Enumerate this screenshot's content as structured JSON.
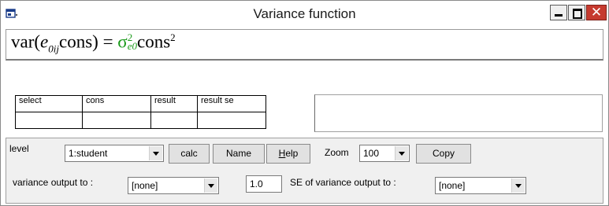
{
  "window": {
    "title": "Variance function"
  },
  "formula": {
    "lhs_func": "var(",
    "lhs_var": "e",
    "lhs_sub": "0ij",
    "lhs_term": "cons",
    "close_eq": ") = ",
    "sigma": "σ",
    "sigma_sup": "2",
    "sigma_sub": "e0",
    "rhs_term": "cons",
    "rhs_sup": "2",
    "sigma_color": "#1a9a1a"
  },
  "table": {
    "headers": [
      "select",
      "cons",
      "result",
      "result se"
    ],
    "row": [
      "",
      "",
      "",
      ""
    ]
  },
  "toolbar": {
    "level_label": "level",
    "level_value": "1:student",
    "calc_label": "calc",
    "name_label": "Name",
    "help_label_rest": "elp",
    "help_label_first": "H",
    "zoom_label": "Zoom",
    "zoom_value": "100",
    "copy_label": "Copy",
    "variance_output_label": "variance output to :",
    "variance_output_value": "[none]",
    "multiplier_value": "1.0",
    "se_output_label": "SE of variance output to :",
    "se_output_value": "[none]"
  }
}
